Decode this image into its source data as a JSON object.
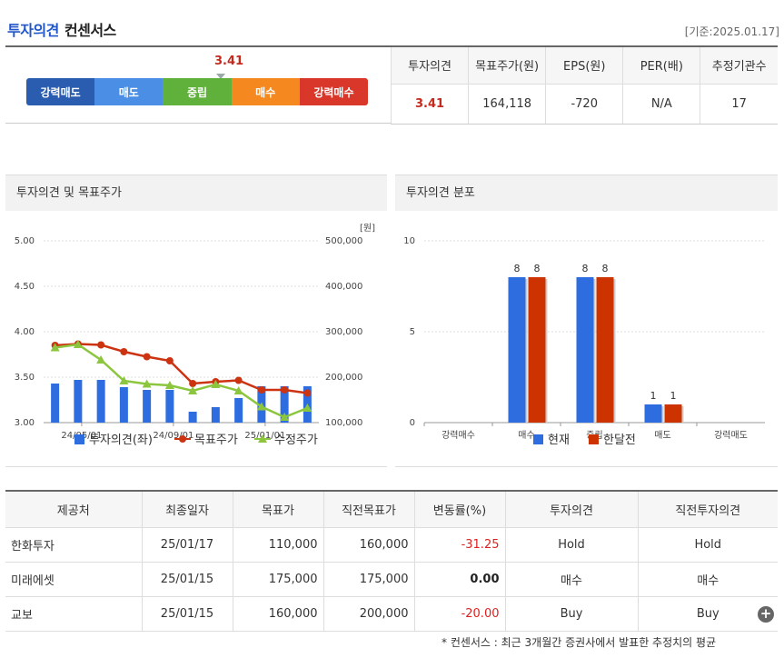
{
  "header": {
    "title_accent": "투자의견",
    "title_rest": "컨센서스",
    "base_date": "[기준:2025.01.17]"
  },
  "scale": {
    "marker_value": "3.41",
    "labels": [
      "강력매도",
      "매도",
      "중립",
      "매수",
      "강력매수"
    ],
    "colors": [
      "#2a5db0",
      "#4a8ee6",
      "#5fb13c",
      "#f5891f",
      "#d8372a"
    ]
  },
  "summary": {
    "headers": [
      "투자의견",
      "목표주가(원)",
      "EPS(원)",
      "PER(배)",
      "추정기관수"
    ],
    "values": [
      "3.41",
      "164,118",
      "-720",
      "N/A",
      "17"
    ]
  },
  "left_chart": {
    "title": "투자의견 및 목표주가",
    "unit_label": "[원]",
    "chart_data": {
      "type": "bar+line",
      "y_left": {
        "min": 3.0,
        "max": 5.0,
        "ticks": [
          "3.00",
          "3.50",
          "4.00",
          "4.50",
          "5.00"
        ]
      },
      "y_right": {
        "min": 100000,
        "max": 500000,
        "ticks": [
          "100,000",
          "200,000",
          "300,000",
          "400,000",
          "500,000"
        ]
      },
      "x_tick_labels": [
        "24/05/01",
        "24/09/01",
        "25/01/01"
      ],
      "series": [
        {
          "name": "투자의견(좌)",
          "type": "bar",
          "color": "#2e6de0",
          "values": [
            3.43,
            3.47,
            3.47,
            3.39,
            3.36,
            3.36,
            3.12,
            3.17,
            3.27,
            3.4,
            3.4,
            3.4
          ]
        },
        {
          "name": "목표주가",
          "type": "line",
          "color": "#cc3311",
          "values": [
            270000,
            273000,
            271000,
            256000,
            245000,
            236000,
            186000,
            190000,
            193000,
            172000,
            172000,
            165000
          ]
        },
        {
          "name": "수정주가",
          "type": "line",
          "color": "#8cc63f",
          "values": [
            265000,
            272000,
            238000,
            192000,
            185000,
            182000,
            170000,
            184000,
            170000,
            135000,
            112000,
            132000
          ]
        }
      ]
    }
  },
  "right_chart": {
    "title": "투자의견 분포",
    "chart_data": {
      "type": "bar",
      "y_ticks": [
        "0",
        "5",
        "10"
      ],
      "ylim": [
        0,
        10
      ],
      "categories": [
        "강력매수",
        "매수",
        "중립",
        "매도",
        "강력매도"
      ],
      "series": [
        {
          "name": "현재",
          "color": "#2e6de0",
          "values": [
            0,
            8,
            8,
            1,
            0
          ]
        },
        {
          "name": "한달전",
          "color": "#cc3300",
          "values": [
            0,
            8,
            8,
            1,
            0
          ]
        }
      ]
    }
  },
  "providers": {
    "headers": [
      "제공처",
      "최종일자",
      "목표가",
      "직전목표가",
      "변동률(%)",
      "투자의견",
      "직전투자의견"
    ],
    "rows": [
      [
        "한화투자",
        "25/01/17",
        "110,000",
        "160,000",
        "-31.25",
        "Hold",
        "Hold"
      ],
      [
        "미래에셋",
        "25/01/15",
        "175,000",
        "175,000",
        "0.00",
        "매수",
        "매수"
      ],
      [
        "교보",
        "25/01/15",
        "160,000",
        "200,000",
        "-20.00",
        "Buy",
        "Buy"
      ]
    ]
  },
  "footnote": "* 컨센서스 : 최근 3개월간 증권사에서 발표한 추정치의 평균"
}
